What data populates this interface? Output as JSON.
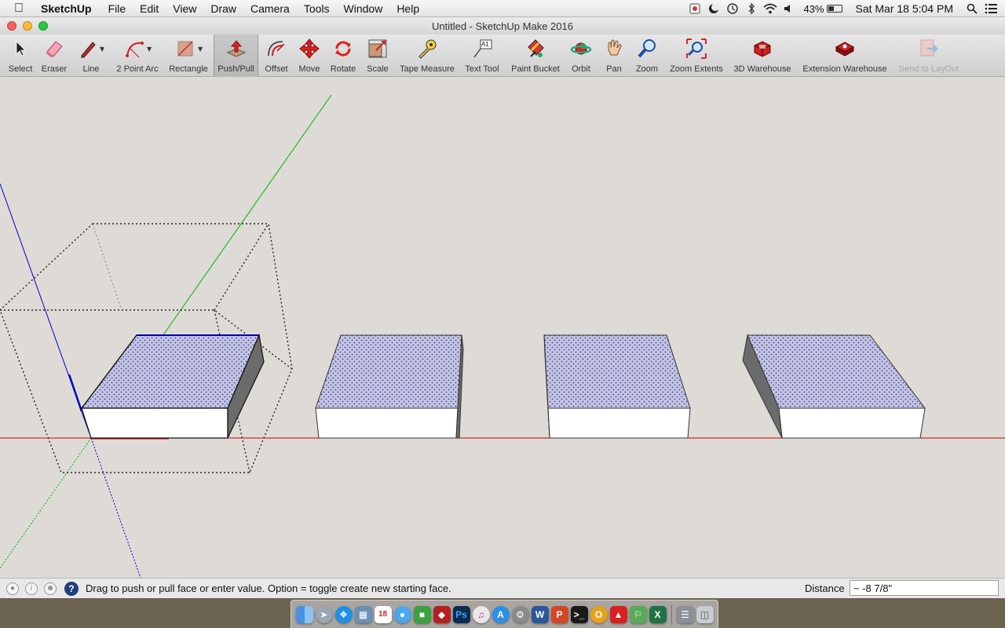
{
  "menubar": {
    "apple_icon": "apple-logo",
    "app_name": "SketchUp",
    "items": [
      "File",
      "Edit",
      "View",
      "Draw",
      "Camera",
      "Tools",
      "Window",
      "Help"
    ],
    "battery_percent": "43%",
    "battery_level": 0.43,
    "clock": "Sat Mar 18  5:04 PM",
    "status_icons": [
      "flag-icon",
      "crescent-icon",
      "time-machine-icon",
      "bluetooth-icon",
      "wifi-icon",
      "volume-icon"
    ]
  },
  "window": {
    "title": "Untitled - SketchUp Make 2016"
  },
  "toolbar": {
    "tools": [
      {
        "label": "Select",
        "icon": "select-arrow-icon"
      },
      {
        "label": "Eraser",
        "icon": "eraser-icon"
      },
      {
        "label": "Line",
        "icon": "pencil-icon"
      },
      {
        "label": "2 Point Arc",
        "icon": "arc-icon"
      },
      {
        "label": "Rectangle",
        "icon": "rectangle-icon"
      },
      {
        "label": "Push/Pull",
        "icon": "push-pull-icon"
      },
      {
        "label": "Offset",
        "icon": "offset-icon"
      },
      {
        "label": "Move",
        "icon": "move-icon"
      },
      {
        "label": "Rotate",
        "icon": "rotate-icon"
      },
      {
        "label": "Scale",
        "icon": "scale-icon"
      },
      {
        "label": "Tape Measure",
        "icon": "tape-measure-icon"
      },
      {
        "label": "Text Tool",
        "icon": "text-tool-icon"
      },
      {
        "label": "Paint Bucket",
        "icon": "paint-bucket-icon"
      },
      {
        "label": "Orbit",
        "icon": "orbit-icon"
      },
      {
        "label": "Pan",
        "icon": "pan-hand-icon"
      },
      {
        "label": "Zoom",
        "icon": "zoom-icon"
      },
      {
        "label": "Zoom Extents",
        "icon": "zoom-extents-icon"
      },
      {
        "label": "3D Warehouse",
        "icon": "3d-warehouse-icon"
      },
      {
        "label": "Extension Warehouse",
        "icon": "extension-warehouse-icon"
      },
      {
        "label": "Send to LayOut",
        "icon": "send-to-layout-icon"
      }
    ],
    "active_tool": "Push/Pull",
    "disabled_tool": "Send to LayOut",
    "text_tool_glyph": "A1"
  },
  "status": {
    "message": "Drag to push or pull face or enter value.  Option = toggle create new starting face.",
    "help_glyph": "?",
    "vcb_label": "Distance",
    "vcb_value": "~ -8 7/8\""
  },
  "colors": {
    "axis_red": "#c80000",
    "axis_green": "#00b000",
    "axis_blue": "#0000cc",
    "face_top": "#b7b9dc",
    "face_front": "#ffffff",
    "face_shadow": "#6b6b6b",
    "background": "#dedbd6"
  },
  "dock": {
    "apps": [
      "finder-icon",
      "launchpad-icon",
      "safari-icon",
      "preview-icon",
      "calendar-icon",
      "messages-icon",
      "facetime-icon",
      "photo-booth-icon",
      "photoshop-icon",
      "itunes-icon",
      "app-store-icon",
      "system-preferences-icon",
      "word-icon",
      "powerpoint-icon",
      "terminal-icon",
      "sketchup-icon",
      "sketchup-red-icon",
      "map-icon",
      "excel-icon",
      "downloads-icon",
      "trash-icon"
    ],
    "calendar_day": "18",
    "photoshop_glyph": "Ps",
    "word_glyph": "W",
    "powerpoint_glyph": "P",
    "excel_glyph": "X"
  }
}
